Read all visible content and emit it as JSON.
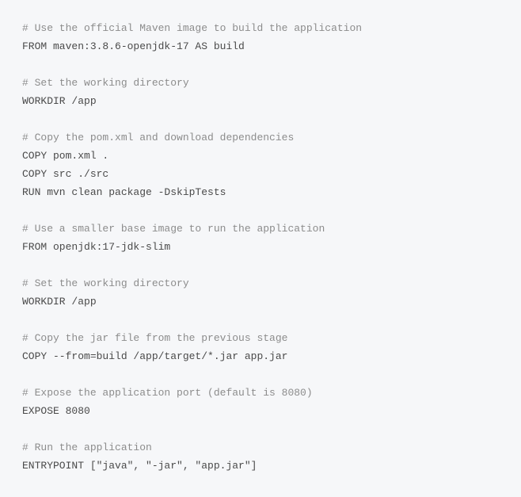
{
  "lines": [
    {
      "type": "comment",
      "text": "# Use the official Maven image to build the application"
    },
    {
      "type": "code",
      "text": "FROM maven:3.8.6-openjdk-17 AS build"
    },
    {
      "type": "blank",
      "text": ""
    },
    {
      "type": "comment",
      "text": "# Set the working directory"
    },
    {
      "type": "code",
      "text": "WORKDIR /app"
    },
    {
      "type": "blank",
      "text": ""
    },
    {
      "type": "comment",
      "text": "# Copy the pom.xml and download dependencies"
    },
    {
      "type": "code",
      "text": "COPY pom.xml ."
    },
    {
      "type": "code",
      "text": "COPY src ./src"
    },
    {
      "type": "code",
      "text": "RUN mvn clean package -DskipTests"
    },
    {
      "type": "blank",
      "text": ""
    },
    {
      "type": "comment",
      "text": "# Use a smaller base image to run the application"
    },
    {
      "type": "code",
      "text": "FROM openjdk:17-jdk-slim"
    },
    {
      "type": "blank",
      "text": ""
    },
    {
      "type": "comment",
      "text": "# Set the working directory"
    },
    {
      "type": "code",
      "text": "WORKDIR /app"
    },
    {
      "type": "blank",
      "text": ""
    },
    {
      "type": "comment",
      "text": "# Copy the jar file from the previous stage"
    },
    {
      "type": "code",
      "text": "COPY --from=build /app/target/*.jar app.jar"
    },
    {
      "type": "blank",
      "text": ""
    },
    {
      "type": "comment",
      "text": "# Expose the application port (default is 8080)"
    },
    {
      "type": "code",
      "text": "EXPOSE 8080"
    },
    {
      "type": "blank",
      "text": ""
    },
    {
      "type": "comment",
      "text": "# Run the application"
    },
    {
      "type": "code",
      "text": "ENTRYPOINT [\"java\", \"-jar\", \"app.jar\"]"
    }
  ]
}
